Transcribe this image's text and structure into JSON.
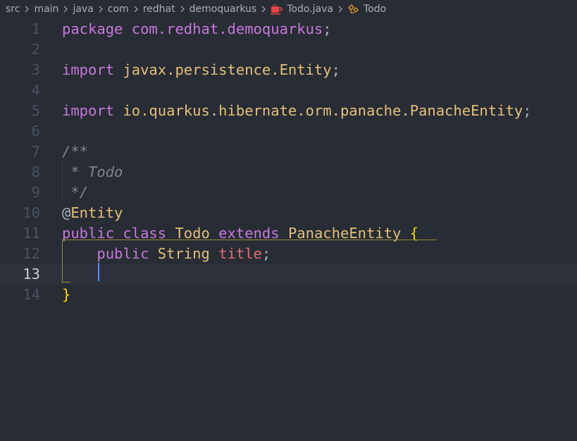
{
  "breadcrumb": {
    "items": [
      "src",
      "main",
      "java",
      "com",
      "redhat",
      "demoquarkus"
    ],
    "file": "Todo.java",
    "symbol": "Todo"
  },
  "editor": {
    "current_line": 13,
    "lines": [
      {
        "n": "1",
        "tokens": [
          {
            "t": "package",
            "c": "kw"
          },
          {
            "t": " ",
            "c": "pn"
          },
          {
            "t": "com.redhat.demoquarkus",
            "c": "pkg"
          },
          {
            "t": ";",
            "c": "pn"
          }
        ]
      },
      {
        "n": "2",
        "tokens": []
      },
      {
        "n": "3",
        "tokens": [
          {
            "t": "import",
            "c": "kw"
          },
          {
            "t": " ",
            "c": "pn"
          },
          {
            "t": "javax.persistence.Entity",
            "c": "ty"
          },
          {
            "t": ";",
            "c": "pn"
          }
        ]
      },
      {
        "n": "4",
        "tokens": []
      },
      {
        "n": "5",
        "tokens": [
          {
            "t": "import",
            "c": "kw"
          },
          {
            "t": " ",
            "c": "pn"
          },
          {
            "t": "io.quarkus.hibernate.orm.panache.PanacheEntity",
            "c": "ty"
          },
          {
            "t": ";",
            "c": "pn"
          }
        ]
      },
      {
        "n": "6",
        "tokens": []
      },
      {
        "n": "7",
        "tokens": [
          {
            "t": "/**",
            "c": "cm"
          }
        ]
      },
      {
        "n": "8",
        "tokens": [
          {
            "t": " * Todo",
            "c": "cm"
          }
        ]
      },
      {
        "n": "9",
        "tokens": [
          {
            "t": " */",
            "c": "cm"
          }
        ]
      },
      {
        "n": "10",
        "tokens": [
          {
            "t": "@",
            "c": "at"
          },
          {
            "t": "Entity",
            "c": "ty"
          }
        ]
      },
      {
        "n": "11",
        "tokens": [
          {
            "t": "public",
            "c": "kw"
          },
          {
            "t": " ",
            "c": "pn"
          },
          {
            "t": "class",
            "c": "kw"
          },
          {
            "t": " ",
            "c": "pn"
          },
          {
            "t": "Todo",
            "c": "ty"
          },
          {
            "t": " ",
            "c": "pn"
          },
          {
            "t": "extends",
            "c": "kw"
          },
          {
            "t": " ",
            "c": "pn"
          },
          {
            "t": "PanacheEntity",
            "c": "ty"
          },
          {
            "t": " ",
            "c": "pn"
          },
          {
            "t": "{",
            "c": "br"
          }
        ]
      },
      {
        "n": "12",
        "tokens": [
          {
            "t": "    ",
            "c": "pn"
          },
          {
            "t": "public",
            "c": "kw"
          },
          {
            "t": " ",
            "c": "pn"
          },
          {
            "t": "String",
            "c": "ty"
          },
          {
            "t": " ",
            "c": "pn"
          },
          {
            "t": "title",
            "c": "fld"
          },
          {
            "t": ";",
            "c": "pn"
          }
        ]
      },
      {
        "n": "13",
        "tokens": [
          {
            "t": "    ",
            "c": "pn"
          }
        ]
      },
      {
        "n": "14",
        "tokens": [
          {
            "t": "}",
            "c": "br"
          }
        ]
      }
    ]
  }
}
